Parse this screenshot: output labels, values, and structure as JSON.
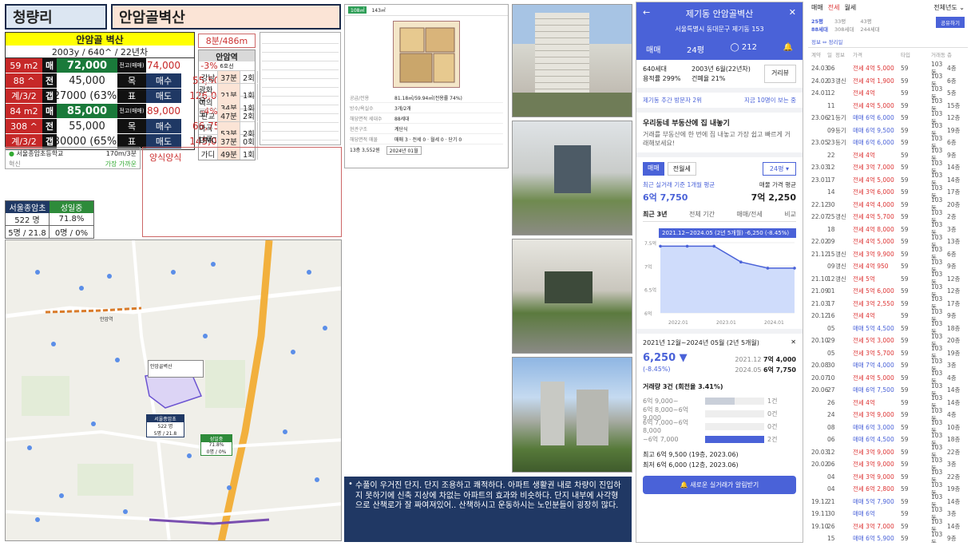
{
  "header": {
    "region": "청량리",
    "complex": "안암골벽산"
  },
  "summary": {
    "name": "안암골 벽산",
    "info": "2003y / 640^ / 22년차",
    "rows": [
      {
        "a": "59 m2",
        "b": "매",
        "c": "72,000",
        "d": "전고(매매)",
        "e": "74,000",
        "f": "-3%"
      },
      {
        "a": "88 ^",
        "b": "전",
        "c": "45,000",
        "d": "목",
        "e": "매수",
        "f": "55,500"
      },
      {
        "a": "계/3/2",
        "b": "갭",
        "c": "27000 (63%)",
        "d": "표",
        "e": "매도",
        "f": "126,000"
      },
      {
        "a": "84 m2",
        "b": "매",
        "c": "85,000",
        "d": "전고(매매)",
        "e": "89,000",
        "f": "-4%"
      },
      {
        "a": "308 ^",
        "b": "전",
        "c": "55,000",
        "d": "목",
        "e": "매수",
        "f": "66,750"
      },
      {
        "a": "계/3/2",
        "b": "갭",
        "c": "30000 (65%)",
        "d": "표",
        "e": "매도",
        "f": "145,000"
      }
    ]
  },
  "commute": {
    "distance": "8분/486m",
    "station": "안암역",
    "line": "6호선",
    "rows": [
      {
        "dest": "강남",
        "time": "37분",
        "tr": "2회"
      },
      {
        "dest": "광화문",
        "time": "21분",
        "tr": "1회"
      },
      {
        "dest": "여의도",
        "time": "34분",
        "tr": "1회"
      },
      {
        "dest": "판교",
        "time": "47분",
        "tr": "2회"
      },
      {
        "dest": "마곡나루",
        "time": "53분",
        "tr": "2회"
      },
      {
        "dest": "DMC",
        "time": "37분",
        "tr": "0회"
      },
      {
        "dest": "가디",
        "time": "49분",
        "tr": "1회"
      }
    ]
  },
  "school": {
    "name": "서울종암초등학교",
    "dist": "170m/3분",
    "tag1": "혁신",
    "tag2": "가장 가까운",
    "label": "양식양식"
  },
  "schools": [
    {
      "name": "서울종암초",
      "students": "522 명",
      "ratio": "5명 / 21.8"
    },
    {
      "name": "성일중",
      "students": "71.8%",
      "ratio": "0명 / 0%"
    }
  ],
  "map": {
    "label1": "안암골벽산",
    "label2": "서울종암초",
    "label3": "성일중",
    "station": "안암역"
  },
  "note": "수풀이 우거진 단지. 단지 조용하고 쾌적하다. 아파트 생활권 내로 차량이 진입하지 못하기에 신축 지상에 차없는 아파트의 효과와 비슷하다. 단지 내부에 사각형으로 산책로가 잘 짜여져있어.. 산책하시고 운동하시는 노인분들이 굉장히 많다.",
  "floorplan": {
    "tab": "108㎡",
    "size": "143㎡",
    "rows": [
      {
        "k": "공급/전용",
        "v": "81.18㎡/59.94㎡(전용률 74%)"
      },
      {
        "k": "방수/욕실수",
        "v": "3개/2개"
      },
      {
        "k": "해당면적 세대수",
        "v": "88세대"
      },
      {
        "k": "현관구조",
        "v": "계단식"
      },
      {
        "k": "해당면적 매물",
        "v": "매매 3 · 전세 0 · 월세 0 · 단기 0"
      }
    ],
    "price_line": "13층 3,552원",
    "year_btn": "2024년 01월"
  },
  "phone": {
    "title": "제기동 안암골벽산",
    "addr": "서울특별시 동대문구 제기동 153",
    "tabs": [
      "매매",
      "24평",
      "212"
    ],
    "info1": "640세대",
    "info2": "2003년 6월(22년차)",
    "info3": "용적률 299%",
    "info4": "건폐율 21%",
    "btn_dist": "거리뷰",
    "visit": "제기동 추간 방문자 2위",
    "visit2": "지금 10명이 보는 중",
    "promo_title": "우리동네 부동산에 집 내놓기",
    "promo_sub": "거래를 부동산에 한 번에 집 내놓고 가장 쉽고 빠르게 거래해보세요!",
    "trade_tabs": [
      "매매",
      "전월세"
    ],
    "size_btn": "24평",
    "recent_label": "최근 실거래 기준 1개월 평균",
    "recent_val": "6억 7,750",
    "ask_label": "매물 가격 평균",
    "ask_val": "7억 2,250",
    "period_tabs": [
      "최근 3년",
      "전체 기간",
      "매매/전세",
      "비교"
    ],
    "chart_banner": "2021.12~2024.05 (2년 5개월)  -6,250 (-8.45%)",
    "range": "2021년 12월~2024년 05월 (2년 5개월)",
    "change": "6,250",
    "change_pct": "(-8.45%)",
    "from_date": "2021.12",
    "from_val": "7억 4,000",
    "to_date": "2024.05",
    "to_val": "6억 7,750",
    "volume": "거래량 3건 (회전율 3.41%)",
    "bars": [
      {
        "label": "6억 9,000~",
        "count": "1건",
        "value": 1
      },
      {
        "label": "6억 8,000~6억 9,000",
        "count": "0건",
        "value": 0
      },
      {
        "label": "6억 7,000~6억 8,000",
        "count": "0건",
        "value": 0
      },
      {
        "label": "~6억 7,000",
        "count": "2건",
        "value": 2
      }
    ],
    "max": "최고 6억 9,500 (19층, 2023.06)",
    "min": "최저 6억 6,000 (12층, 2023.06)",
    "cta": "새로운 실거래가 알림받기"
  },
  "chart_data": {
    "type": "line",
    "x": [
      "2021.12",
      "2022.06",
      "2022.12",
      "2023.06",
      "2023.12",
      "2024.05"
    ],
    "series": [
      {
        "values": [
          74000,
          74000,
          74000,
          69500,
          67750,
          67750
        ]
      }
    ],
    "ylim": [
      55000,
      75000
    ],
    "yticks": [
      "7.5억",
      "7억",
      "6.5억",
      "6억"
    ],
    "xticks": [
      "2022.01",
      "2023.01",
      "2024.01"
    ]
  },
  "trades": {
    "tabs": [
      "매매",
      "전세",
      "월세"
    ],
    "filter": "전체년도",
    "cols": [
      "계약",
      "일",
      "정보",
      "가격",
      "타입",
      "거래동",
      "층"
    ],
    "rows": [
      [
        "24.03",
        "06",
        "",
        "전세 4억 5,000",
        "59",
        "103동",
        "4층"
      ],
      [
        "24.02",
        "03",
        "갱신",
        "전세 4억 1,900",
        "59",
        "103동",
        "6층"
      ],
      [
        "24.01",
        "12",
        "",
        "전세 4억",
        "59",
        "103동",
        "5층"
      ],
      [
        "",
        "11",
        "",
        "전세 4억 5,000",
        "59",
        "103동",
        "15층"
      ],
      [
        "23.06",
        "21",
        "등기",
        "매매 6억 6,000",
        "59",
        "103동",
        "12층"
      ],
      [
        "",
        "09",
        "등기",
        "매매 6억 9,500",
        "59",
        "103동",
        "19층"
      ],
      [
        "23.05",
        "23",
        "등기",
        "매매 6억 6,000",
        "59",
        "103동",
        "6층"
      ],
      [
        "",
        "22",
        "",
        "전세 4억",
        "59",
        "103동",
        "9층"
      ],
      [
        "23.03",
        "12",
        "",
        "전세 3억 7,000",
        "59",
        "103동",
        "14층"
      ],
      [
        "23.01",
        "17",
        "",
        "전세 4억 5,000",
        "59",
        "103동",
        "14층"
      ],
      [
        "",
        "14",
        "",
        "전세 3억 6,000",
        "59",
        "103동",
        "17층"
      ],
      [
        "22.12",
        "30",
        "",
        "전세 4억 4,000",
        "59",
        "103동",
        "20층"
      ],
      [
        "22.07",
        "25",
        "갱신",
        "전세 4억 5,700",
        "59",
        "103동",
        "2층"
      ],
      [
        "",
        "18",
        "",
        "전세 4억 8,000",
        "59",
        "103동",
        "3층"
      ],
      [
        "22.02",
        "09",
        "",
        "전세 4억 5,000",
        "59",
        "103동",
        "13층"
      ],
      [
        "21.12",
        "15",
        "갱신",
        "전세 3억 9,900",
        "59",
        "103동",
        "6층"
      ],
      [
        "",
        "09",
        "갱신",
        "전세 4억 950",
        "59",
        "103동",
        "9층"
      ],
      [
        "21.10",
        "12",
        "갱신",
        "전세 5억",
        "59",
        "103동",
        "12층"
      ],
      [
        "21.09",
        "01",
        "",
        "전세 5억 6,000",
        "59",
        "103동",
        "12층"
      ],
      [
        "21.03",
        "17",
        "",
        "전세 3억 2,550",
        "59",
        "103동",
        "17층"
      ],
      [
        "20.12",
        "16",
        "",
        "전세 4억",
        "59",
        "103동",
        "9층"
      ],
      [
        "",
        "05",
        "",
        "매매 5억 4,500",
        "59",
        "103동",
        "18층"
      ],
      [
        "20.10",
        "29",
        "",
        "전세 5억 3,000",
        "59",
        "103동",
        "20층"
      ],
      [
        "",
        "05",
        "",
        "전세 3억 5,700",
        "59",
        "103동",
        "19층"
      ],
      [
        "20.08",
        "30",
        "",
        "매매 7억 4,000",
        "59",
        "103동",
        "3층"
      ],
      [
        "20.07",
        "10",
        "",
        "전세 4억 5,000",
        "59",
        "103동",
        "4층"
      ],
      [
        "20.06",
        "27",
        "",
        "매매 6억 7,500",
        "59",
        "103동",
        "14층"
      ],
      [
        "",
        "26",
        "",
        "전세 4억",
        "59",
        "103동",
        "14층"
      ],
      [
        "",
        "24",
        "",
        "전세 3억 9,000",
        "59",
        "103동",
        "4층"
      ],
      [
        "",
        "08",
        "",
        "매매 6억 3,000",
        "59",
        "103동",
        "10층"
      ],
      [
        "",
        "06",
        "",
        "매매 6억 4,500",
        "59",
        "103동",
        "18층"
      ],
      [
        "20.03",
        "12",
        "",
        "전세 3억 9,000",
        "59",
        "103동",
        "22층"
      ],
      [
        "20.02",
        "06",
        "",
        "전세 3억 9,000",
        "59",
        "103동",
        "3층"
      ],
      [
        "",
        "04",
        "",
        "전세 3억 9,000",
        "59",
        "103동",
        "22층"
      ],
      [
        "",
        "04",
        "",
        "전세 6억 2,800",
        "59",
        "103동",
        "19층"
      ],
      [
        "19.12",
        "21",
        "",
        "매매 5억 7,900",
        "59",
        "103동",
        "14층"
      ],
      [
        "19.11",
        "30",
        "",
        "매매 6억",
        "59",
        "103동",
        "3층"
      ],
      [
        "19.10",
        "26",
        "",
        "전세 3억 7,000",
        "59",
        "103동",
        "14층"
      ],
      [
        "",
        "15",
        "",
        "매매 6억 5,900",
        "59",
        "103동",
        "9층"
      ],
      [
        "",
        "09",
        "",
        "매매 5억 5,700",
        "59",
        "103동",
        "3층"
      ],
      [
        "",
        "04",
        "",
        "전세 3억 6,000",
        "59",
        "103동",
        "22층"
      ]
    ]
  }
}
